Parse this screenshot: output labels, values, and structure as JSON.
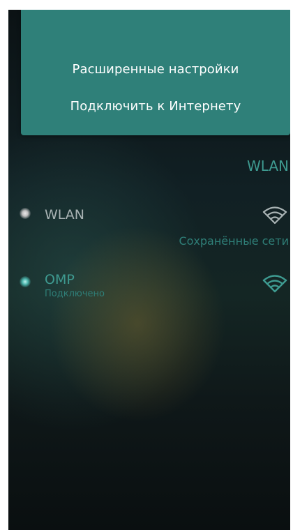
{
  "pulley_menu": {
    "items": [
      {
        "label": "Расширенные настройки"
      },
      {
        "label": "Подключить к Интернету"
      }
    ]
  },
  "page": {
    "header": "WLAN"
  },
  "wlan_switch": {
    "label": "WLAN",
    "icon": "wifi-icon"
  },
  "saved_networks": {
    "section_label": "Сохранённые сети",
    "networks": [
      {
        "name": "OMP",
        "status": "Подключено",
        "icon": "wifi-icon"
      }
    ]
  },
  "colors": {
    "menu_background": "#2f8079",
    "highlight": "#3e9a90",
    "secondary_highlight": "#2f7f78",
    "primary_text": "#a9b3b4"
  }
}
